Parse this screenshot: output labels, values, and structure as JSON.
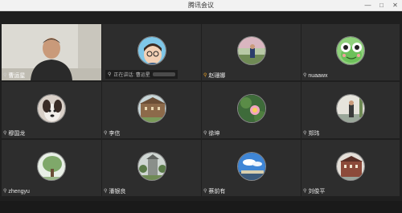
{
  "window": {
    "title": "腾讯会议"
  },
  "participants": [
    {
      "name": "曹运星",
      "mic": "muted",
      "type": "video"
    },
    {
      "name": "",
      "mic": "muted",
      "type": "avatar",
      "speaking_label": "正在讲话: 曹运星",
      "avatar": "cartoon-glasses"
    },
    {
      "name": "赵珊娜",
      "mic": "active",
      "type": "avatar",
      "avatar": "outdoor-person"
    },
    {
      "name": "nuaawx",
      "mic": "muted",
      "type": "avatar",
      "avatar": "frog"
    },
    {
      "name": "穆国龙",
      "mic": "muted",
      "type": "avatar",
      "avatar": "dog"
    },
    {
      "name": "李信",
      "mic": "muted",
      "type": "avatar",
      "avatar": "building"
    },
    {
      "name": "徐坤",
      "mic": "muted",
      "type": "avatar",
      "avatar": "lotus"
    },
    {
      "name": "郑玮",
      "mic": "muted",
      "type": "avatar",
      "avatar": "person-standing"
    },
    {
      "name": "zhengyu",
      "mic": "muted",
      "type": "avatar",
      "avatar": "tree"
    },
    {
      "name": "潘银良",
      "mic": "muted",
      "type": "avatar",
      "avatar": "tower"
    },
    {
      "name": "蔡前有",
      "mic": "muted",
      "type": "avatar",
      "avatar": "sky"
    },
    {
      "name": "刘俊平",
      "mic": "muted",
      "type": "avatar",
      "avatar": "red-building"
    }
  ],
  "colors": {
    "tile_bg": "#2d2d2d",
    "mic_active": "#f5a623"
  }
}
